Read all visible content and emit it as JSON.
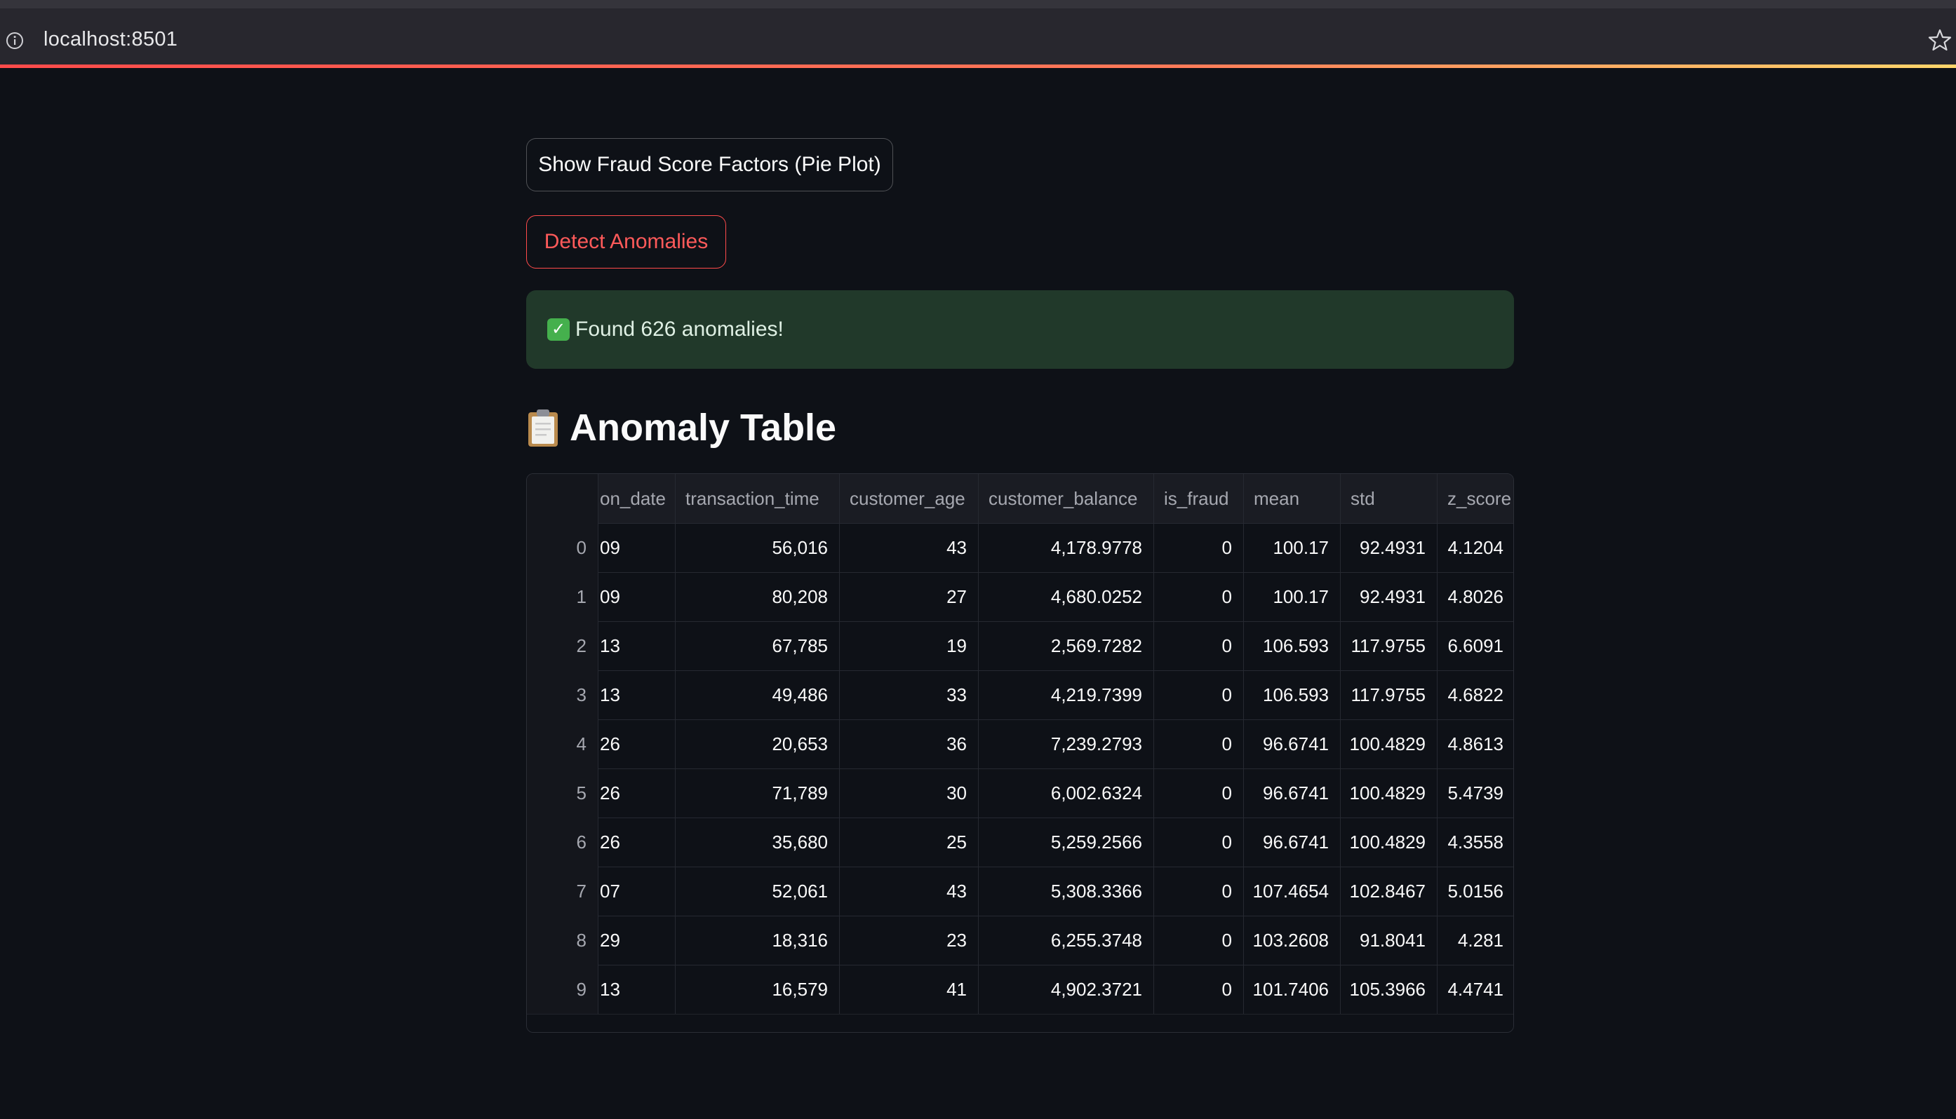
{
  "browser": {
    "url": "localhost:8501"
  },
  "buttons": {
    "pie_plot": "Show Fraud Score Factors (Pie Plot)",
    "detect": "Detect Anomalies"
  },
  "alert": {
    "message": "Found 626 anomalies!"
  },
  "section": {
    "title": "Anomaly Table"
  },
  "table": {
    "columns": [
      "",
      "on_date",
      "transaction_time",
      "customer_age",
      "customer_balance",
      "is_fraud",
      "mean",
      "std",
      "z_score"
    ],
    "rows": [
      [
        "0",
        "09",
        "56,016",
        "43",
        "4,178.9778",
        "0",
        "100.17",
        "92.4931",
        "4.1204"
      ],
      [
        "1",
        "09",
        "80,208",
        "27",
        "4,680.0252",
        "0",
        "100.17",
        "92.4931",
        "4.8026"
      ],
      [
        "2",
        "13",
        "67,785",
        "19",
        "2,569.7282",
        "0",
        "106.593",
        "117.9755",
        "6.6091"
      ],
      [
        "3",
        "13",
        "49,486",
        "33",
        "4,219.7399",
        "0",
        "106.593",
        "117.9755",
        "4.6822"
      ],
      [
        "4",
        "26",
        "20,653",
        "36",
        "7,239.2793",
        "0",
        "96.6741",
        "100.4829",
        "4.8613"
      ],
      [
        "5",
        "26",
        "71,789",
        "30",
        "6,002.6324",
        "0",
        "96.6741",
        "100.4829",
        "5.4739"
      ],
      [
        "6",
        "26",
        "35,680",
        "25",
        "5,259.2566",
        "0",
        "96.6741",
        "100.4829",
        "4.3558"
      ],
      [
        "7",
        "07",
        "52,061",
        "43",
        "5,308.3366",
        "0",
        "107.4654",
        "102.8467",
        "5.0156"
      ],
      [
        "8",
        "29",
        "18,316",
        "23",
        "6,255.3748",
        "0",
        "103.2608",
        "91.8041",
        "4.281"
      ],
      [
        "9",
        "13",
        "16,579",
        "41",
        "4,902.3721",
        "0",
        "101.7406",
        "105.3966",
        "4.4741"
      ]
    ]
  }
}
